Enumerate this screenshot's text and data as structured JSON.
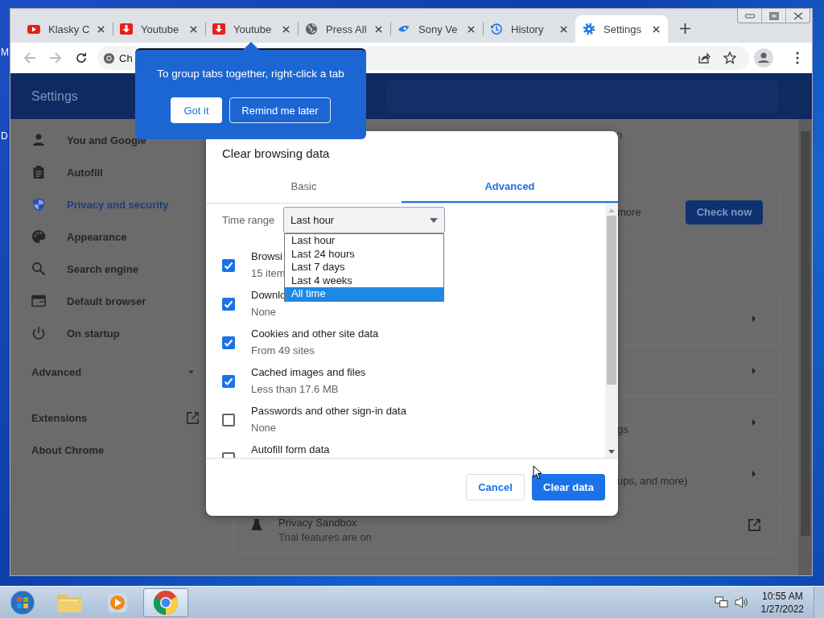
{
  "desktop": {
    "edge_labels": [
      "M",
      "D"
    ]
  },
  "browser": {
    "tabs": [
      {
        "title": "Klasky C",
        "kind": "youtube",
        "selected": false
      },
      {
        "title": "Youtube",
        "kind": "download",
        "selected": false
      },
      {
        "title": "Youtube",
        "kind": "download",
        "selected": false
      },
      {
        "title": "Press All",
        "kind": "globe",
        "selected": false
      },
      {
        "title": "Sony Ve",
        "kind": "bird",
        "selected": false
      },
      {
        "title": "History",
        "kind": "history",
        "selected": false
      },
      {
        "title": "Settings",
        "kind": "gear",
        "selected": true
      }
    ],
    "address_bar": {
      "value": "Ch"
    },
    "settings": {
      "title": "Settings",
      "sidebar": {
        "items": [
          {
            "label": "You and Google",
            "kind": "person",
            "selected": false
          },
          {
            "label": "Autofill",
            "kind": "clipboard",
            "selected": false
          },
          {
            "label": "Privacy and security",
            "kind": "shield",
            "selected": true
          },
          {
            "label": "Appearance",
            "kind": "palette",
            "selected": false
          },
          {
            "label": "Search engine",
            "kind": "search",
            "selected": false
          },
          {
            "label": "Default browser",
            "kind": "browser",
            "selected": false
          },
          {
            "label": "On startup",
            "kind": "power",
            "selected": false
          }
        ],
        "advanced": {
          "label": "Advanced",
          "expanded": false
        },
        "links": [
          {
            "label": "Extensions",
            "external": true
          },
          {
            "label": "About Chrome",
            "external": false
          }
        ]
      },
      "top_fragment": "n",
      "safety_card": {
        "text": "more",
        "button": "Check now"
      },
      "rows": [
        {
          "kind": "submenu"
        },
        {
          "kind": "submenu"
        },
        {
          "kind": "submenu",
          "subtitle": "gs"
        },
        {
          "kind": "submenu",
          "subtitle": "ups, and more)"
        },
        {
          "kind": "external",
          "title": "Privacy Sandbox",
          "subtitle": "Trial features are on"
        }
      ]
    }
  },
  "dialog": {
    "title": "Clear browsing data",
    "tabs": [
      {
        "label": "Basic",
        "selected": false
      },
      {
        "label": "Advanced",
        "selected": true
      }
    ],
    "time_range": {
      "label": "Time range",
      "value": "Last hour"
    },
    "options": [
      {
        "label": "Browsi",
        "detail": "15 item",
        "checked": true
      },
      {
        "label": "Downlo",
        "detail": "None",
        "checked": true
      },
      {
        "label": "Cookies and other site data",
        "detail": "From 49 sites",
        "checked": true
      },
      {
        "label": "Cached images and files",
        "detail": "Less than 17.6 MB",
        "checked": true
      },
      {
        "label": "Passwords and other sign-in data",
        "detail": "None",
        "checked": false
      },
      {
        "label": "Autofill form data",
        "checked": false
      }
    ],
    "buttons": [
      {
        "label": "Cancel",
        "kind": "secondary"
      },
      {
        "label": "Clear data",
        "kind": "primary"
      }
    ]
  },
  "dropdown": {
    "options": [
      {
        "label": "Last hour",
        "selected": false
      },
      {
        "label": "Last 24 hours",
        "selected": false
      },
      {
        "label": "Last 7 days",
        "selected": false
      },
      {
        "label": "Last 4 weeks",
        "selected": false
      },
      {
        "label": "All time",
        "selected": true
      }
    ]
  },
  "tooltip": {
    "text": "To group tabs together, right-click a tab",
    "buttons": [
      {
        "label": "Got it",
        "kind": "primary"
      },
      {
        "label": "Remind me later",
        "kind": "secondary"
      }
    ]
  },
  "taskbar": {
    "apps": [
      {
        "kind": "start",
        "selected": false
      },
      {
        "kind": "folder",
        "selected": false
      },
      {
        "kind": "media",
        "selected": false
      },
      {
        "kind": "chrome",
        "selected": true
      }
    ],
    "clock": {
      "time": "10:55 AM",
      "date": "1/27/2022"
    }
  }
}
